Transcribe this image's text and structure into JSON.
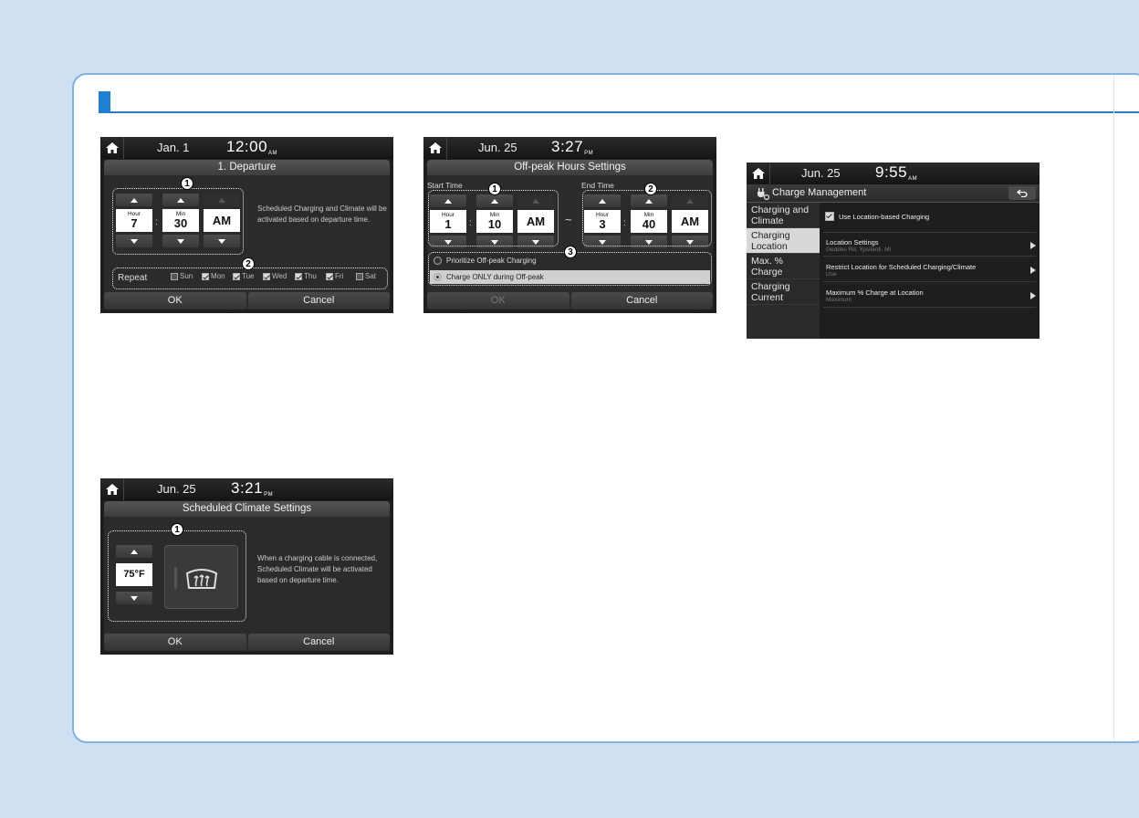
{
  "departure": {
    "date": "Jan.  1",
    "time": "12:00",
    "ampm": "AM",
    "title": "1. Departure",
    "hour_label": "Hour",
    "hour_value": "7",
    "min_label": "Min",
    "min_value": "30",
    "period_value": "AM",
    "info": "Scheduled Charging and Climate  will be activated based on  departure time.",
    "repeat_label": "Repeat",
    "days": [
      {
        "label": "Sun",
        "checked": false
      },
      {
        "label": "Mon",
        "checked": true
      },
      {
        "label": "Tue",
        "checked": true
      },
      {
        "label": "Wed",
        "checked": true
      },
      {
        "label": "Thu",
        "checked": true
      },
      {
        "label": "Fri",
        "checked": true
      },
      {
        "label": "Sat",
        "checked": false
      }
    ],
    "badge1": "1",
    "badge2": "2",
    "ok_label": "OK",
    "cancel_label": "Cancel"
  },
  "offpeak": {
    "date": "Jun. 25",
    "time": "3:27",
    "ampm": "PM",
    "title": "Off-peak Hours Settings",
    "start_label": "Start Time",
    "end_label": "End Time",
    "start": {
      "hour_label": "Hour",
      "hour": "1",
      "min_label": "Min",
      "min": "10",
      "period": "AM"
    },
    "end": {
      "hour_label": "Hour",
      "hour": "3",
      "min_label": "Min",
      "min": "40",
      "period": "AM"
    },
    "tilde": "~",
    "option1": "Prioritize Off-peak Charging",
    "option2": "Charge ONLY during Off-peak",
    "badge1": "1",
    "badge2": "2",
    "badge3": "3",
    "ok_label": "OK",
    "cancel_label": "Cancel"
  },
  "charge_mgmt": {
    "date": "Jun. 25",
    "time": "9:55",
    "ampm": "AM",
    "title": "Charge Management",
    "side_items": [
      "Charging and Climate",
      "Charging Location",
      "Max. % Charge",
      "Charging Current"
    ],
    "active_side_index": 1,
    "use_location": "Use Location-based Charging",
    "rows": [
      {
        "title": "Location Settings",
        "sub": "Geddes Rd, Ypsilanti, MI"
      },
      {
        "title": "Restrict Location for Scheduled Charging/Climate",
        "sub": "Use"
      },
      {
        "title": "Maximum % Charge at Location",
        "sub": "Maximum"
      }
    ]
  },
  "climate": {
    "date": "Jun. 25",
    "time": "3:21",
    "ampm": "PM",
    "title": "Scheduled Climate Settings",
    "temp": "75°F",
    "info": "When a charging cable is connected, Scheduled Climate will be activated based on departure time.",
    "badge1": "1",
    "ok_label": "OK",
    "cancel_label": "Cancel"
  },
  "icons": {
    "home": "home-icon",
    "defrost": "rear-defrost-icon",
    "back": "back-arrow-icon",
    "charge": "charge-management-icon"
  },
  "colors": {
    "accent": "#1f7fd0",
    "page_bg": "#cfe0f3",
    "screen_bg": "#1e1e1e"
  }
}
